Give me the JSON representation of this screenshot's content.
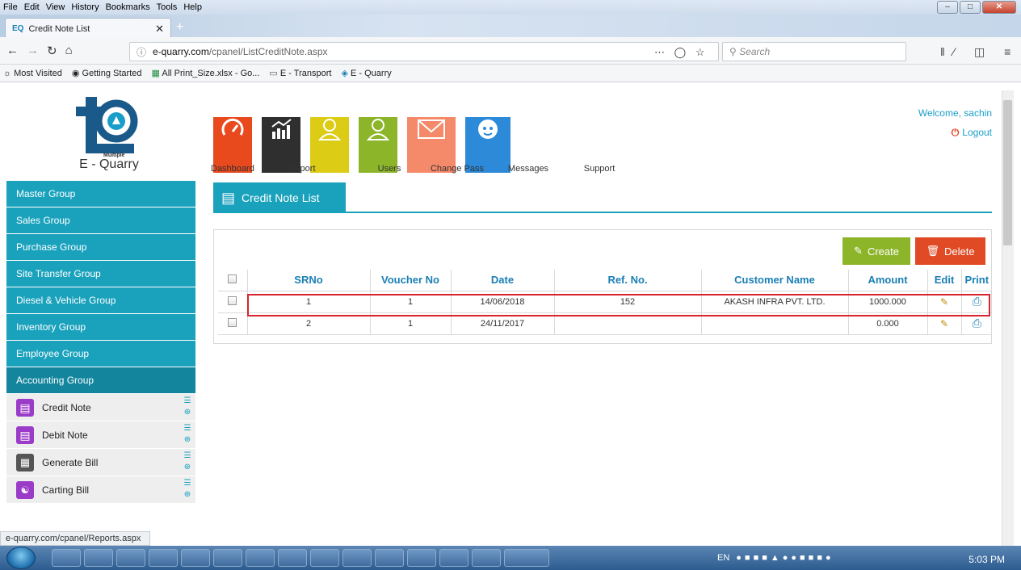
{
  "browser": {
    "menu": [
      "File",
      "Edit",
      "View",
      "History",
      "Bookmarks",
      "Tools",
      "Help"
    ],
    "tab_title": "Credit Note List",
    "url_host": "e-quarry.com",
    "url_path": "/cpanel/ListCreditNote.aspx",
    "search_placeholder": "Search",
    "bookmarks": [
      "Most Visited",
      "Getting Started",
      "All Print_Size.xlsx - Go...",
      "E - Transport",
      "E - Quarry"
    ],
    "status_url": "e-quarry.com/cpanel/Reports.aspx"
  },
  "header": {
    "brand": "E - Quarry",
    "brand_sub": "Multiple",
    "welcome": "Welcome, sachin",
    "logout": "Logout",
    "tiles": [
      {
        "label": "Dashboard",
        "color": "#e8491d",
        "icon": "speedometer-icon"
      },
      {
        "label": "Report",
        "color": "#2f2f2f",
        "icon": "chart-icon"
      },
      {
        "label": "Users",
        "color": "#dccc15",
        "icon": "user-icon"
      },
      {
        "label": "Change Pass",
        "color": "#8cb52a",
        "icon": "user-key-icon"
      },
      {
        "label": "Messages",
        "color": "#f58a6a",
        "icon": "envelope-icon"
      },
      {
        "label": "Support",
        "color": "#2c8ad8",
        "icon": "support-icon"
      }
    ]
  },
  "sidebar": {
    "groups": [
      "Master Group",
      "Sales Group",
      "Purchase Group",
      "Site Transfer Group",
      "Diesel & Vehicle Group",
      "Inventory Group",
      "Employee Group",
      "Accounting Group"
    ],
    "active_group": "Accounting Group",
    "subitems": [
      {
        "label": "Credit Note",
        "color": "#9b3cc9"
      },
      {
        "label": "Debit Note",
        "color": "#9b3cc9"
      },
      {
        "label": "Generate Bill",
        "color": "#555555"
      },
      {
        "label": "Carting Bill",
        "color": "#9b3cc9"
      }
    ]
  },
  "main": {
    "title": "Credit Note List",
    "create_label": "Create",
    "delete_label": "Delete",
    "columns": [
      "SRNo",
      "Voucher No",
      "Date",
      "Ref. No.",
      "Customer Name",
      "Amount",
      "Edit",
      "Print"
    ],
    "rows": [
      {
        "srno": "1",
        "voucher": "1",
        "date": "14/06/2018",
        "ref": "152",
        "customer": "AKASH INFRA PVT. LTD.",
        "amount": "1000.000"
      },
      {
        "srno": "2",
        "voucher": "1",
        "date": "24/11/2017",
        "ref": "",
        "customer": "",
        "amount": "0.000"
      }
    ]
  },
  "taskbar": {
    "lang": "EN",
    "time": "5:03 PM"
  }
}
